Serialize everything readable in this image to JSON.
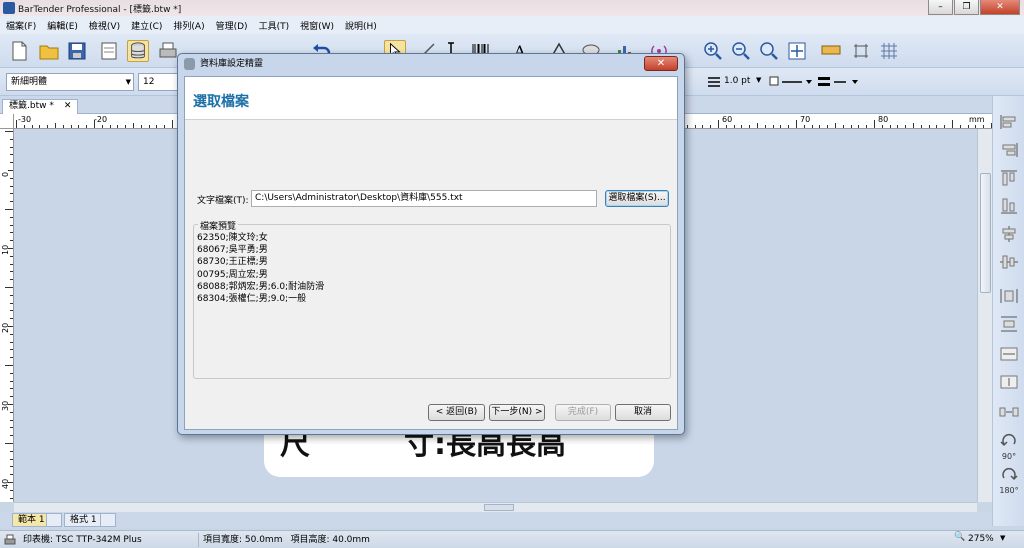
{
  "app": {
    "title": "BarTender Professional - [標籤.btw *]",
    "window_controls": {
      "minimize": "–",
      "restore": "❐",
      "close": "✕"
    }
  },
  "menubar": [
    "檔案(F)",
    "編輯(E)",
    "檢視(V)",
    "建立(C)",
    "排列(A)",
    "管理(D)",
    "工具(T)",
    "視窗(W)",
    "說明(H)"
  ],
  "format_toolbar": {
    "font_name": "新細明體",
    "font_size": "12",
    "line_width": "1.0 pt"
  },
  "document_tab": {
    "label": "標籤.btw *",
    "close": "✕"
  },
  "rulers": {
    "horizontal_labels": [
      "-30",
      "-20",
      "60",
      "70",
      "80",
      "mm"
    ],
    "vertical_labels": [
      "0",
      "10",
      "20",
      "30",
      "40"
    ]
  },
  "canvas": {
    "label_text_left": "尺",
    "label_text_right": "寸:長高長高"
  },
  "right_toolbar": {
    "rotate_90": "90°",
    "rotate_180": "180°"
  },
  "sheet_tabs": [
    {
      "label": "範本 1",
      "active": true
    },
    {
      "label": "格式 1",
      "active": false
    }
  ],
  "statusbar": {
    "printer": "印表機: TSC TTP-342M Plus",
    "item_width": "項目寬度: 50.0mm",
    "item_height": "項目高度: 40.0mm",
    "zoom": "275%"
  },
  "dialog": {
    "title": "資料庫設定精靈",
    "heading": "選取檔案",
    "text_file_label": "文字檔案(T):",
    "text_file_value": "C:\\Users\\Administrator\\Desktop\\資料庫\\555.txt",
    "browse_button": "選取檔案(S)...",
    "preview_title": "檔案預覽",
    "preview_lines": [
      "62350;陳文玲;女",
      "68067;吳平勇;男",
      "68730;王正標;男",
      "00795;周立宏;男",
      "68088;郭炳宏;男;6.0;耐油防滑",
      "68304;張權仁;男;9.0;一般"
    ],
    "back_button": "< 返回(B)",
    "next_button": "下一步(N) >",
    "finish_button": "完成(F)",
    "cancel_button": "取消",
    "close_glyph": "✕"
  },
  "colors": {
    "heading": "#1c70a8",
    "canvas_bg": "#c8d6e8",
    "active_sheet_tab": "#f5e7a8"
  }
}
